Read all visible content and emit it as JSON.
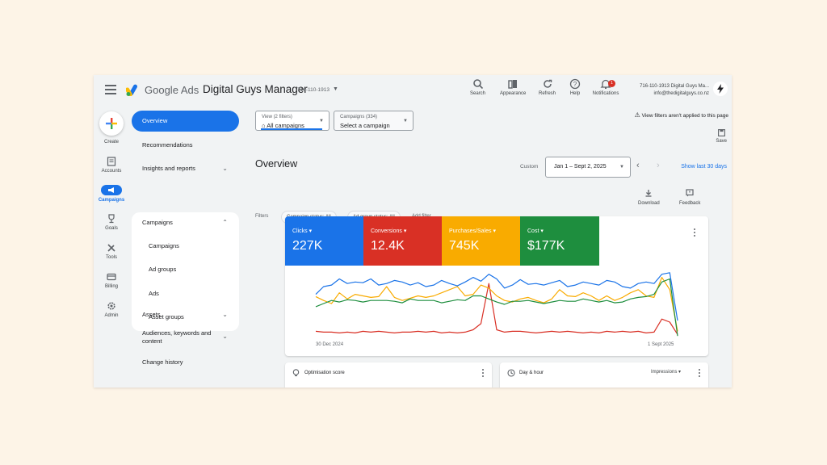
{
  "header": {
    "brand": "Google Ads",
    "account_name": "Digital Guys Manager",
    "account_id": "716-110-1913",
    "tools": [
      {
        "label": "Search",
        "icon": "search-icon"
      },
      {
        "label": "Appearance",
        "icon": "appearance-icon"
      },
      {
        "label": "Refresh",
        "icon": "refresh-icon"
      },
      {
        "label": "Help",
        "icon": "help-icon"
      },
      {
        "label": "Notifications",
        "icon": "bell-icon"
      }
    ],
    "notification_count": "1",
    "account_line1": "716-110-1913 Digital Guys Ma...",
    "account_line2": "info@thedigitalguys.co.nz"
  },
  "rail": {
    "create": "Create",
    "items": [
      {
        "label": "Accounts",
        "icon": "accounts-icon"
      },
      {
        "label": "Campaigns",
        "icon": "campaigns-icon"
      },
      {
        "label": "Goals",
        "icon": "goals-icon"
      },
      {
        "label": "Tools",
        "icon": "tools-icon"
      },
      {
        "label": "Billing",
        "icon": "billing-icon"
      },
      {
        "label": "Admin",
        "icon": "admin-icon"
      }
    ]
  },
  "nav": {
    "overview": "Overview",
    "recommendations": "Recommendations",
    "insights": "Insights and reports",
    "campaigns": "Campaigns",
    "sub": [
      "Campaigns",
      "Ad groups",
      "Ads",
      "Asset groups"
    ],
    "assets": "Assets",
    "audiences": "Audiences, keywords and content",
    "change_history": "Change history"
  },
  "filters": {
    "view_small": "View (2 filters)",
    "view_value": "All campaigns",
    "campaigns_small": "Campaigns (334)",
    "campaigns_value": "Select a campaign",
    "label": "Filters",
    "chips": [
      "Campaign status: All",
      "Ad group status: All"
    ],
    "add_filter": "Add filter",
    "warning": "View filters aren't applied to this page",
    "save": "Save"
  },
  "page": {
    "title": "Overview",
    "date_label": "Custom",
    "date_range": "Jan 1 – Sept 2, 2025",
    "show_last": "Show last 30 days",
    "download": "Download",
    "feedback": "Feedback"
  },
  "colors": {
    "clicks": "#1a73e8",
    "conversions": "#d93025",
    "purchases": "#f9ab00",
    "cost": "#1e8e3e"
  },
  "metrics": [
    {
      "label": "Clicks",
      "value": "227K"
    },
    {
      "label": "Conversions",
      "value": "12.4K"
    },
    {
      "label": "Purchases/Sales",
      "value": "745K"
    },
    {
      "label": "Cost",
      "value": "$177K"
    }
  ],
  "chart_data": {
    "type": "line",
    "x_start": "30 Dec 2024",
    "x_end": "1 Sept 2025",
    "series": [
      {
        "name": "Clicks",
        "values": [
          58,
          68,
          70,
          78,
          72,
          74,
          73,
          78,
          70,
          72,
          76,
          74,
          70,
          73,
          68,
          70,
          76,
          72,
          69,
          74,
          80,
          75,
          84,
          78,
          66,
          70,
          77,
          71,
          72,
          70,
          73,
          76,
          68,
          70,
          74,
          72,
          70,
          76,
          74,
          68,
          66,
          72,
          74,
          72,
          84,
          86,
          24
        ]
      },
      {
        "name": "Conversions",
        "values": [
          10,
          9,
          9,
          8,
          9,
          8,
          10,
          9,
          10,
          9,
          8,
          9,
          9,
          10,
          9,
          10,
          8,
          9,
          8,
          9,
          12,
          20,
          72,
          12,
          9,
          10,
          10,
          9,
          8,
          9,
          10,
          9,
          10,
          9,
          8,
          9,
          8,
          10,
          9,
          10,
          9,
          10,
          8,
          9,
          26,
          22,
          6
        ]
      },
      {
        "name": "Purchases/Sales",
        "values": [
          55,
          50,
          46,
          60,
          52,
          58,
          56,
          54,
          55,
          68,
          54,
          50,
          53,
          56,
          54,
          56,
          60,
          64,
          68,
          56,
          58,
          70,
          66,
          56,
          50,
          48,
          52,
          54,
          50,
          47,
          52,
          64,
          56,
          55,
          60,
          56,
          50,
          56,
          50,
          54,
          60,
          64,
          56,
          54,
          80,
          64,
          10
        ]
      },
      {
        "name": "Cost",
        "values": [
          42,
          46,
          50,
          48,
          51,
          50,
          48,
          50,
          50,
          50,
          49,
          47,
          52,
          50,
          50,
          50,
          47,
          49,
          51,
          50,
          56,
          56,
          52,
          48,
          45,
          49,
          49,
          50,
          48,
          46,
          48,
          50,
          49,
          49,
          52,
          50,
          48,
          50,
          47,
          48,
          52,
          54,
          55,
          58,
          74,
          78,
          4
        ]
      }
    ]
  },
  "cards": {
    "optimisation": "Optimisation score",
    "day_hour": "Day & hour",
    "impressions": "Impressions"
  }
}
